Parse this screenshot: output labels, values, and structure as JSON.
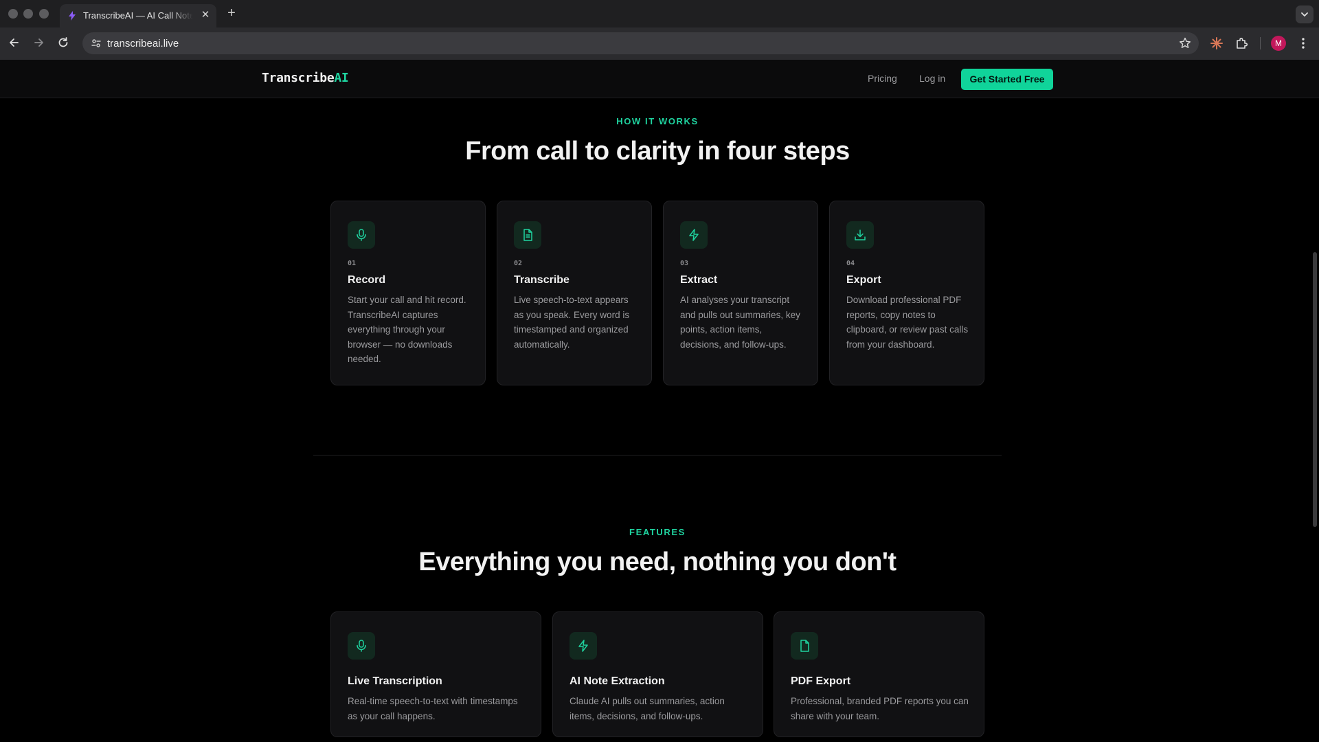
{
  "browser": {
    "tab_title": "TranscribeAI — AI Call Note Taker",
    "url": "transcribeai.live",
    "avatar_letter": "M"
  },
  "header": {
    "logo_main": "Transcribe",
    "logo_accent": "AI",
    "nav": [
      "Pricing",
      "Log in"
    ],
    "cta": "Get Started Free"
  },
  "how_it_works": {
    "eyebrow": "HOW IT WORKS",
    "heading": "From call to clarity in four steps",
    "steps": [
      {
        "num": "01",
        "icon": "microphone-icon",
        "title": "Record",
        "desc": "Start your call and hit record. TranscribeAI captures everything through your browser — no downloads needed."
      },
      {
        "num": "02",
        "icon": "document-icon",
        "title": "Transcribe",
        "desc": "Live speech-to-text appears as you speak. Every word is timestamped and organized automatically."
      },
      {
        "num": "03",
        "icon": "lightning-icon",
        "title": "Extract",
        "desc": "AI analyses your transcript and pulls out summaries, key points, action items, decisions, and follow-ups."
      },
      {
        "num": "04",
        "icon": "download-icon",
        "title": "Export",
        "desc": "Download professional PDF reports, copy notes to clipboard, or review past calls from your dashboard."
      }
    ]
  },
  "features": {
    "eyebrow": "FEATURES",
    "heading": "Everything you need, nothing you don't",
    "items": [
      {
        "icon": "microphone-icon",
        "title": "Live Transcription",
        "desc": "Real-time speech-to-text with timestamps as your call happens."
      },
      {
        "icon": "lightning-icon",
        "title": "AI Note Extraction",
        "desc": "Claude AI pulls out summaries, action items, decisions, and follow-ups."
      },
      {
        "icon": "file-icon",
        "title": "PDF Export",
        "desc": "Professional, branded PDF reports you can share with your team."
      }
    ]
  },
  "colors": {
    "accent": "#1fd4a0",
    "cta_bg": "#10d49a",
    "background": "#000000",
    "card_bg": "#111113"
  }
}
